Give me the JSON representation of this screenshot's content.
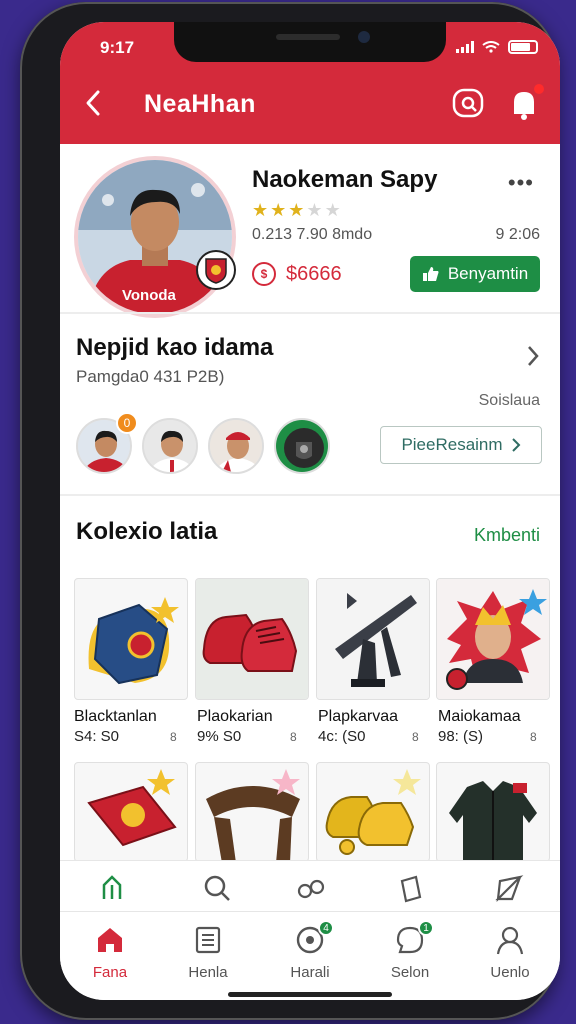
{
  "status": {
    "time": "9:17"
  },
  "header": {
    "title": "NeaHhan"
  },
  "profile": {
    "name": "Naokeman Sapy",
    "rating": 3,
    "rating_max": 5,
    "stat_left": "0.213 7.90 8mdo",
    "stat_right": "9 2:06",
    "coin_value": "$6666",
    "follow_label": "Benyamtin",
    "jersey_text": "Vonoda"
  },
  "friends": {
    "title": "Nepjid kao idama",
    "subtitle": "Pamgda0 431 P2B)",
    "right_label": "Soislaua",
    "badge_count": "0",
    "button_label": "PieeResainm"
  },
  "collection": {
    "title": "Kolexio latia",
    "link": "Kmbenti",
    "items": [
      {
        "name": "Blacktanlan",
        "price": "S4: S0",
        "extra": "8"
      },
      {
        "name": "Plaokarian",
        "price": "9% S0",
        "extra": "8"
      },
      {
        "name": "Plapkarvaa",
        "price": "4c: (S0",
        "extra": "8"
      },
      {
        "name": "Maiokamaa",
        "price": "98: (S)",
        "extra": "8"
      }
    ]
  },
  "bottom_nav": [
    {
      "label": "Fana",
      "icon": "home-icon",
      "active": true
    },
    {
      "label": "Henla",
      "icon": "list-icon"
    },
    {
      "label": "Harali",
      "icon": "compass-icon",
      "badge": "4"
    },
    {
      "label": "Selon",
      "icon": "chat-icon",
      "badge": "1"
    },
    {
      "label": "Uenlo",
      "icon": "user-icon"
    }
  ],
  "colors": {
    "brand": "#d42a3b",
    "accent": "#1e8e45"
  }
}
